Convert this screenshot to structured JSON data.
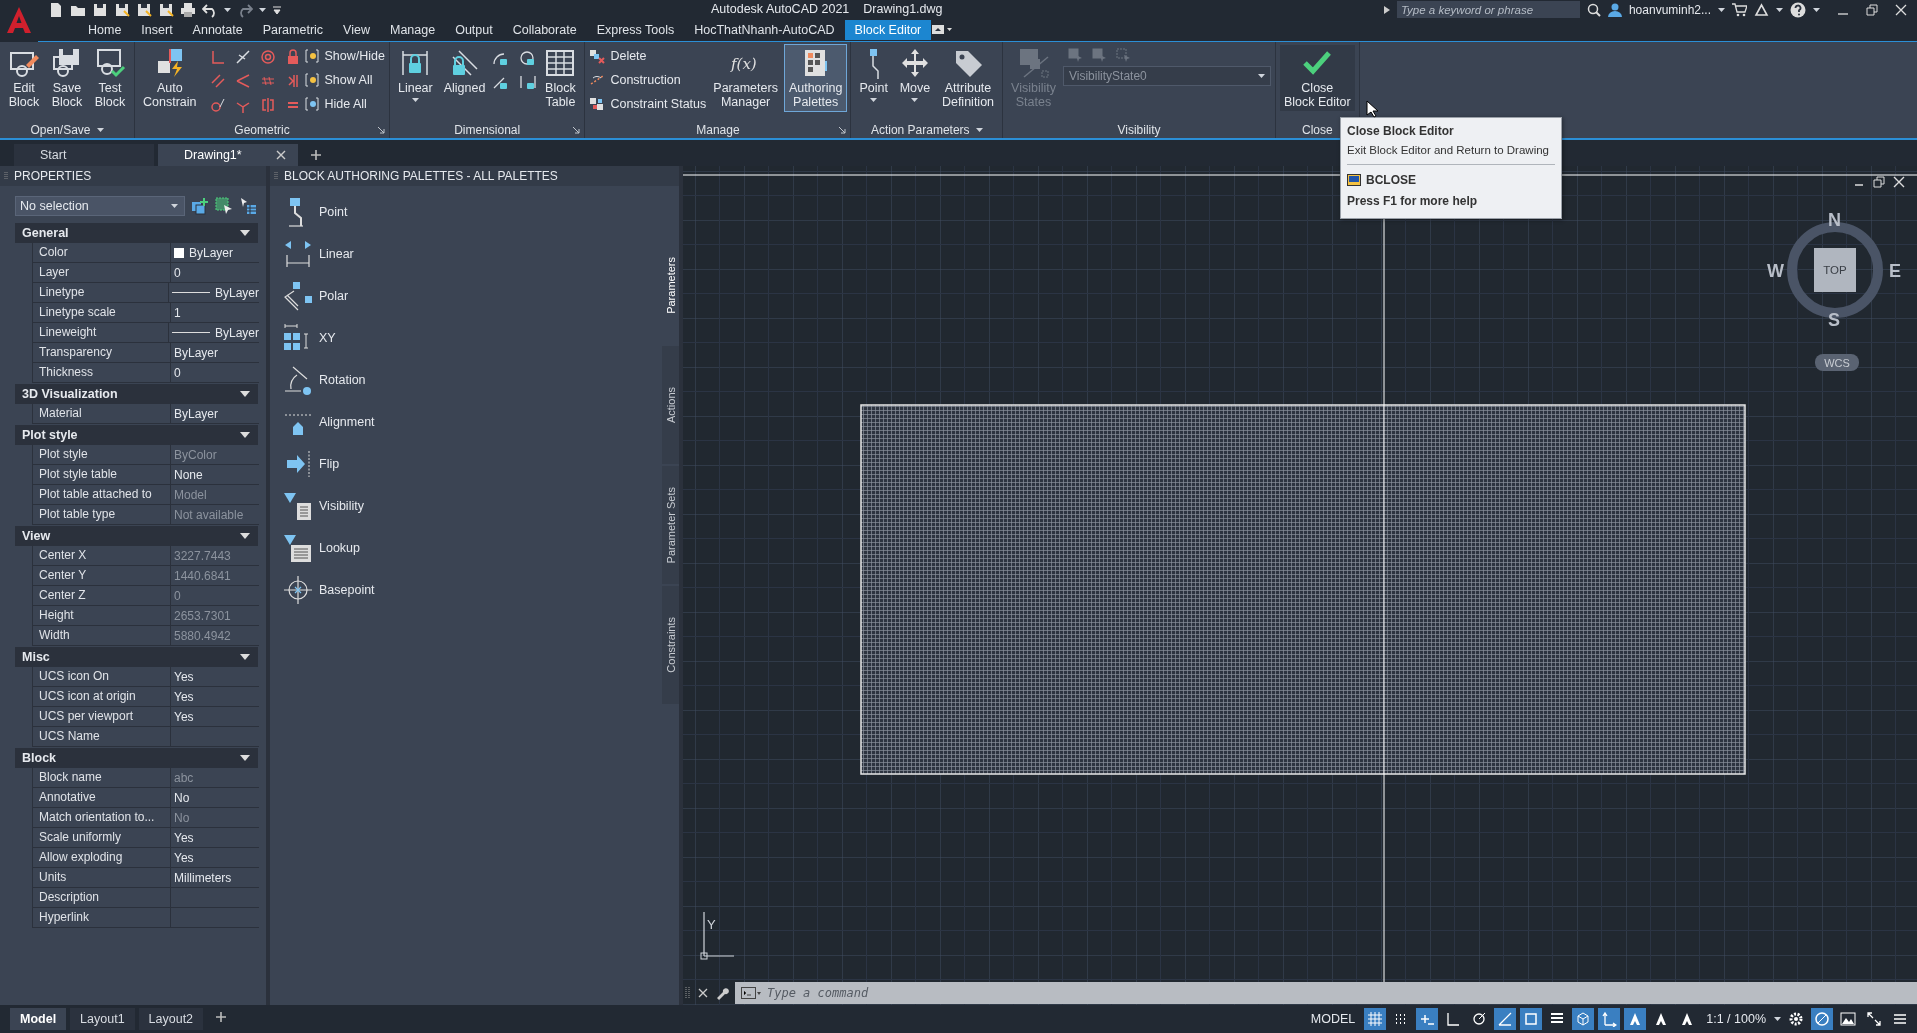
{
  "window": {
    "app_title": "Autodesk AutoCAD 2021",
    "file_name": "Drawing1.dwg"
  },
  "search": {
    "placeholder": "Type a keyword or phrase"
  },
  "user": {
    "name": "hoanvuminh2..."
  },
  "menu_tabs": [
    {
      "label": "Home",
      "selected": false
    },
    {
      "label": "Insert",
      "selected": false
    },
    {
      "label": "Annotate",
      "selected": false
    },
    {
      "label": "Parametric",
      "selected": false
    },
    {
      "label": "View",
      "selected": false
    },
    {
      "label": "Manage",
      "selected": false
    },
    {
      "label": "Output",
      "selected": false
    },
    {
      "label": "Collaborate",
      "selected": false
    },
    {
      "label": "Express Tools",
      "selected": false
    },
    {
      "label": "HocThatNhanh-AutoCAD",
      "selected": false
    },
    {
      "label": "Block Editor",
      "selected": true
    }
  ],
  "ribbon": [
    {
      "title": "Open/Save",
      "menu": true,
      "launcher": false,
      "tools": [
        {
          "kind": "large",
          "lines": [
            "Edit",
            "Block"
          ],
          "active": false,
          "disabled": false,
          "dropdown": false
        },
        {
          "kind": "large",
          "lines": [
            "Save",
            "Block"
          ],
          "active": false,
          "disabled": false,
          "dropdown": false
        },
        {
          "kind": "large",
          "lines": [
            "Test",
            "Block"
          ],
          "active": false,
          "disabled": false,
          "dropdown": false
        }
      ]
    },
    {
      "title": "Geometric",
      "menu": false,
      "launcher": true,
      "tools": [
        {
          "kind": "large",
          "lines": [
            "Auto",
            "Constrain"
          ],
          "active": false,
          "disabled": false,
          "dropdown": false
        },
        {
          "kind": "icon_grid"
        },
        {
          "kind": "stack",
          "items": [
            {
              "label": "Show/Hide"
            },
            {
              "label": "Show All"
            },
            {
              "label": "Hide All"
            }
          ]
        }
      ]
    },
    {
      "title": "Dimensional",
      "menu": false,
      "launcher": true,
      "tools": [
        {
          "kind": "large",
          "lines": [
            "Linear"
          ],
          "active": false,
          "disabled": false,
          "dropdown": true
        },
        {
          "kind": "large",
          "lines": [
            "Aligned"
          ],
          "active": false,
          "disabled": false,
          "dropdown": false
        },
        {
          "kind": "icon_grid"
        },
        {
          "kind": "large",
          "lines": [
            "Block",
            "Table"
          ],
          "active": false,
          "disabled": false,
          "dropdown": false
        }
      ]
    },
    {
      "title": "Manage",
      "menu": false,
      "launcher": true,
      "tools": [
        {
          "kind": "stack",
          "items": [
            {
              "label": "Delete"
            },
            {
              "label": "Construction"
            },
            {
              "label": "Constraint Status"
            }
          ]
        },
        {
          "kind": "large",
          "lines": [
            "Parameters",
            "Manager"
          ],
          "glyph": "f(x)",
          "active": false,
          "disabled": false,
          "dropdown": false
        },
        {
          "kind": "large",
          "lines": [
            "Authoring",
            "Palettes"
          ],
          "active": true,
          "disabled": false,
          "dropdown": false
        }
      ]
    },
    {
      "title": "Action Parameters",
      "menu": true,
      "launcher": false,
      "tools": [
        {
          "kind": "large",
          "lines": [
            "Point"
          ],
          "active": false,
          "disabled": false,
          "dropdown": true
        },
        {
          "kind": "large",
          "lines": [
            "Move"
          ],
          "active": false,
          "disabled": false,
          "dropdown": true
        },
        {
          "kind": "large",
          "lines": [
            "Attribute",
            "Definition"
          ],
          "active": false,
          "disabled": false,
          "dropdown": false
        }
      ]
    },
    {
      "title": "Visibility",
      "menu": false,
      "launcher": false,
      "tools": [
        {
          "kind": "large",
          "lines": [
            "Visibility",
            "States"
          ],
          "active": false,
          "disabled": true,
          "dropdown": false
        },
        {
          "kind": "combo",
          "value": "VisibilityState0",
          "disabled": true
        }
      ]
    },
    {
      "title": "Close",
      "menu": false,
      "launcher": false,
      "tools": [
        {
          "kind": "large",
          "lines": [
            "Close",
            "Block Editor"
          ],
          "active": true,
          "disabled": false,
          "dropdown": false
        }
      ]
    }
  ],
  "tooltip": {
    "title": "Close Block Editor",
    "description": "Exit Block Editor and Return to Drawing",
    "command": "BCLOSE",
    "help": "Press F1 for more help"
  },
  "doc_tabs": [
    {
      "label": "Start",
      "selected": false,
      "closable": false
    },
    {
      "label": "Drawing1*",
      "selected": true,
      "closable": true
    }
  ],
  "properties": {
    "title": "PROPERTIES",
    "selection": "No selection",
    "sections": [
      {
        "title": "General",
        "expanded": true,
        "rows": [
          {
            "label": "Color",
            "value": "ByLayer",
            "kind": "color",
            "disabled": false
          },
          {
            "label": "Layer",
            "value": "0",
            "kind": "text",
            "disabled": false
          },
          {
            "label": "Linetype",
            "value": "ByLayer",
            "kind": "line",
            "disabled": false
          },
          {
            "label": "Linetype scale",
            "value": "1",
            "kind": "text",
            "disabled": false
          },
          {
            "label": "Lineweight",
            "value": "ByLayer",
            "kind": "line",
            "disabled": false
          },
          {
            "label": "Transparency",
            "value": "ByLayer",
            "kind": "text",
            "disabled": false
          },
          {
            "label": "Thickness",
            "value": "0",
            "kind": "text",
            "disabled": false
          }
        ]
      },
      {
        "title": "3D Visualization",
        "expanded": true,
        "rows": [
          {
            "label": "Material",
            "value": "ByLayer",
            "kind": "text",
            "disabled": false
          }
        ]
      },
      {
        "title": "Plot style",
        "expanded": true,
        "rows": [
          {
            "label": "Plot style",
            "value": "ByColor",
            "kind": "text",
            "disabled": true
          },
          {
            "label": "Plot style table",
            "value": "None",
            "kind": "text",
            "disabled": false
          },
          {
            "label": "Plot table attached to",
            "value": "Model",
            "kind": "text",
            "disabled": true
          },
          {
            "label": "Plot table type",
            "value": "Not available",
            "kind": "text",
            "disabled": true
          }
        ]
      },
      {
        "title": "View",
        "expanded": true,
        "rows": [
          {
            "label": "Center X",
            "value": "3227.7443",
            "kind": "text",
            "disabled": true
          },
          {
            "label": "Center Y",
            "value": "1440.6841",
            "kind": "text",
            "disabled": true
          },
          {
            "label": "Center Z",
            "value": "0",
            "kind": "text",
            "disabled": true
          },
          {
            "label": "Height",
            "value": "2653.7301",
            "kind": "text",
            "disabled": true
          },
          {
            "label": "Width",
            "value": "5880.4942",
            "kind": "text",
            "disabled": true
          }
        ]
      },
      {
        "title": "Misc",
        "expanded": true,
        "rows": [
          {
            "label": "UCS icon On",
            "value": "Yes",
            "kind": "text",
            "disabled": false
          },
          {
            "label": "UCS icon at origin",
            "value": "Yes",
            "kind": "text",
            "disabled": false
          },
          {
            "label": "UCS per viewport",
            "value": "Yes",
            "kind": "text",
            "disabled": false
          },
          {
            "label": "UCS Name",
            "value": "",
            "kind": "text",
            "disabled": false
          }
        ]
      },
      {
        "title": "Block",
        "expanded": true,
        "rows": [
          {
            "label": "Block name",
            "value": "abc",
            "kind": "text",
            "disabled": true
          },
          {
            "label": "Annotative",
            "value": "No",
            "kind": "text",
            "disabled": false
          },
          {
            "label": "Match orientation to...",
            "value": "No",
            "kind": "text",
            "disabled": true
          },
          {
            "label": "Scale uniformly",
            "value": "Yes",
            "kind": "text",
            "disabled": false
          },
          {
            "label": "Allow exploding",
            "value": "Yes",
            "kind": "text",
            "disabled": false
          },
          {
            "label": "Units",
            "value": "Millimeters",
            "kind": "text",
            "disabled": false
          },
          {
            "label": "Description",
            "value": "",
            "kind": "text",
            "disabled": false
          },
          {
            "label": "Hyperlink",
            "value": "",
            "kind": "text",
            "disabled": false
          }
        ]
      }
    ]
  },
  "palette": {
    "title": "BLOCK AUTHORING PALETTES - ALL PALETTES",
    "items": [
      {
        "label": "Point"
      },
      {
        "label": "Linear"
      },
      {
        "label": "Polar"
      },
      {
        "label": "XY"
      },
      {
        "label": "Rotation"
      },
      {
        "label": "Alignment"
      },
      {
        "label": "Flip"
      },
      {
        "label": "Visibility"
      },
      {
        "label": "Lookup"
      },
      {
        "label": "Basepoint"
      }
    ],
    "side_tabs": [
      {
        "label": "Parameters",
        "selected": true
      },
      {
        "label": "Actions",
        "selected": false
      },
      {
        "label": "Parameter Sets",
        "selected": false
      },
      {
        "label": "Constraints",
        "selected": false
      }
    ]
  },
  "viewcube": {
    "north": "N",
    "east": "E",
    "south": "S",
    "west": "W",
    "face": "TOP",
    "ucs": "WCS"
  },
  "ucs_label": "Y",
  "command_line": {
    "placeholder": "Type a command"
  },
  "layout_tabs": [
    {
      "label": "Model",
      "selected": true
    },
    {
      "label": "Layout1",
      "selected": false
    },
    {
      "label": "Layout2",
      "selected": false
    }
  ],
  "status_bar": {
    "space": "MODEL",
    "scale": "1:1 / 100%",
    "toggles": [
      {
        "kind": "grid",
        "on": true
      },
      {
        "kind": "snap",
        "on": false
      },
      {
        "kind": "infer",
        "on": true
      },
      {
        "kind": "ortho",
        "on": false
      },
      {
        "kind": "polar",
        "on": false
      },
      {
        "kind": "isodraft",
        "on": true
      },
      {
        "kind": "osnap",
        "on": true
      },
      {
        "kind": "lineweight",
        "on": false
      },
      {
        "kind": "cube",
        "on": true
      },
      {
        "kind": "ucs",
        "on": true
      },
      {
        "kind": "annotate",
        "on": true
      },
      {
        "kind": "autoscale",
        "on": false
      },
      {
        "kind": "annoscale",
        "on": false
      }
    ],
    "tail_toggles": [
      {
        "kind": "gear",
        "on": false
      },
      {
        "kind": "isolate",
        "on": true
      },
      {
        "kind": "hardware",
        "on": false
      },
      {
        "kind": "fullscreen",
        "on": false
      },
      {
        "kind": "menu",
        "on": false
      }
    ]
  }
}
